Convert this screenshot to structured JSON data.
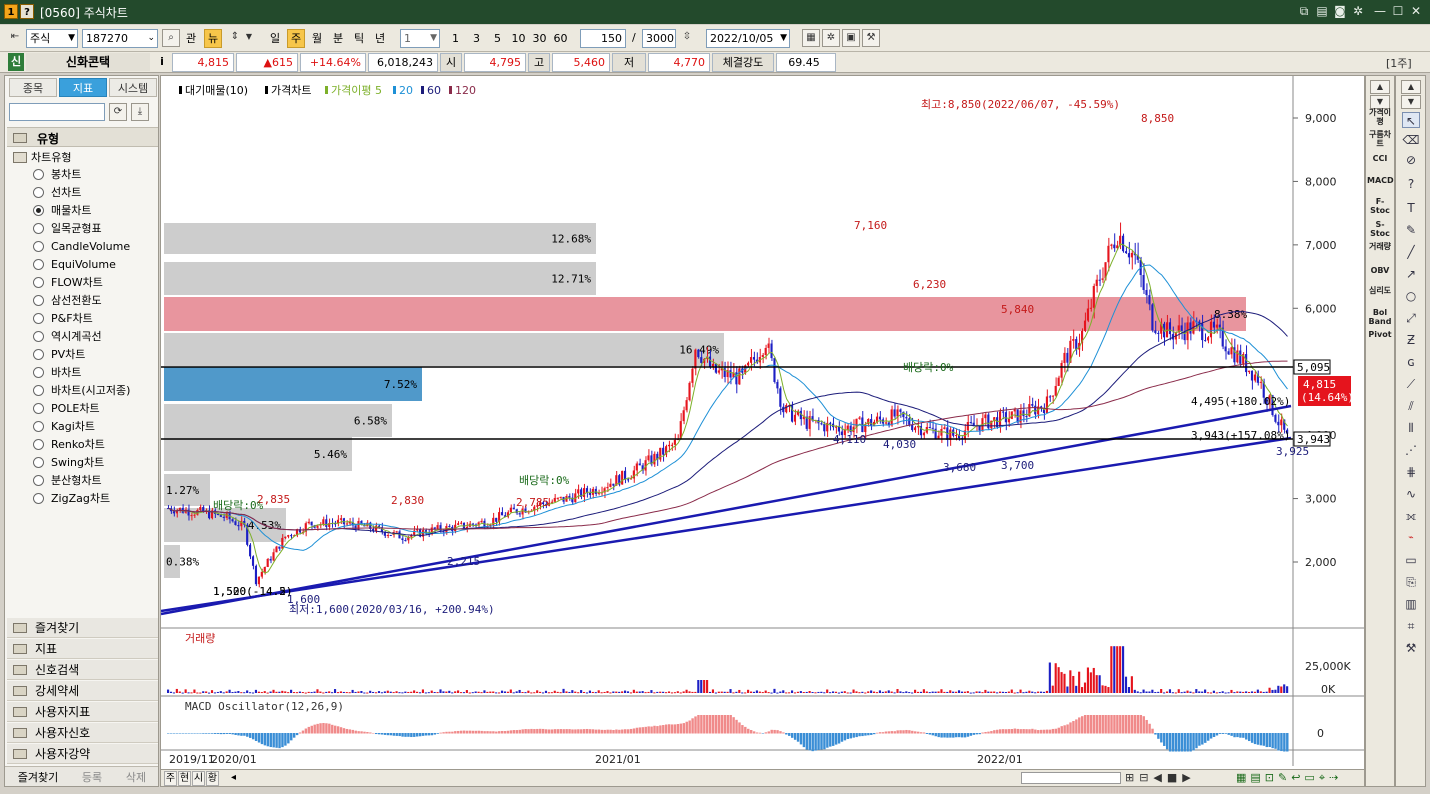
{
  "window": {
    "title": "[0560] 주식차트",
    "icon1": "1",
    "icon2": "?"
  },
  "toolbar": {
    "market": "주식",
    "code": "187270",
    "btn_gwan": "관",
    "btn_news": "뉴",
    "periods": [
      "일",
      "주",
      "월",
      "분",
      "틱",
      "년"
    ],
    "active_period": "주",
    "interval": "1",
    "intervals": [
      "1",
      "3",
      "5",
      "10",
      "30",
      "60"
    ],
    "count": "150",
    "total": "3000",
    "slash": "/",
    "date": "2022/10/05"
  },
  "quote": {
    "badge": "신",
    "name": "신화콘택",
    "info": "i",
    "price": "4,815",
    "change": "▲615",
    "pct": "+14.64%",
    "volume": "6,018,243",
    "open_label": "시",
    "open": "4,795",
    "high_label": "고",
    "high": "5,460",
    "low_label": "저",
    "low": "4,770",
    "strength_label": "체결강도",
    "strength": "69.45",
    "unit": "[1주]"
  },
  "left": {
    "tabs": [
      "종목",
      "지표",
      "시스템"
    ],
    "active_tab": "지표",
    "section": "유형",
    "group": "차트유형",
    "types": [
      "봉차트",
      "선차트",
      "매물차트",
      "일목균형표",
      "CandleVolume",
      "EquiVolume",
      "FLOW차트",
      "삼선전환도",
      "P&F차트",
      "역시계곡선",
      "PV차트",
      "바차트",
      "바차트(시고저종)",
      "POLE차트",
      "Kagi차트",
      "Renko차트",
      "Swing차트",
      "분산형차트",
      "ZigZag차트"
    ],
    "selected": "매물차트",
    "folders": [
      "즐겨찾기",
      "지표",
      "신호검색",
      "강세약세",
      "사용자지표",
      "사용자신호",
      "사용자강약"
    ],
    "bottom_tabs": [
      "즐겨찾기",
      "등록",
      "삭제"
    ]
  },
  "chart": {
    "legend": {
      "item1": "대기매물(10)",
      "item2": "가격차트",
      "item3": "가격이평 5",
      "ma20": "20",
      "ma60": "60",
      "ma120": "120"
    },
    "volume_title": "거래량",
    "macd_title": "MACD Oscillator(12,26,9)",
    "price_ticks": [
      "9,000",
      "8,000",
      "7,000",
      "6,000",
      "4,000",
      "3,000",
      "2,000"
    ],
    "price_tick_values": [
      9000,
      8000,
      7000,
      6000,
      4000,
      3000,
      2000
    ],
    "volume_ticks": [
      "25,000K",
      "0K"
    ],
    "macd_ticks": [
      "0"
    ],
    "time_labels": [
      "2019/11",
      "2020/01",
      "2021/01",
      "2022/01"
    ],
    "profile_labels": [
      "12.68%",
      "12.71%",
      "8.38%",
      "16.49%",
      "7.52%",
      "6.58%",
      "5.46%",
      "1.27%",
      "4.53%",
      "0.38%"
    ],
    "annotations": {
      "high": "최고:8,850(2022/06/07, -45.59%)",
      "low": "최저:1,600(2020/03/16, +200.94%)",
      "p8850": "8,850",
      "p7160": "7,160",
      "p6230": "6,230",
      "p5840": "5,840",
      "p4110": "4,110",
      "p4030": "4,030",
      "p3680": "3,680",
      "p3700": "3,700",
      "p3925": "3,925",
      "p2835": "2,835",
      "p2830": "2,830",
      "p2785": "2,785",
      "p2215": "2,215",
      "p1600": "1,600",
      "div1": "배당락:0%",
      "div2": "배당락:0%",
      "div3": "배당락:0%",
      "trend1": "4,495(+180.02%)",
      "trend2": "3,943(+157.08%)",
      "left1": "1,500(-14.5)",
      "left2": "1,520(-14.2)"
    },
    "price_box": {
      "current": "4,815",
      "current_pct": "(14.64%)",
      "line1": "5,095",
      "line2": "3,943"
    }
  },
  "right_indicators": [
    "가격이평",
    "구름차트",
    "CCI",
    "MACD",
    "F-Stoc",
    "S-Stoc",
    "거래량",
    "OBV",
    "심리도",
    "Bol Band",
    "Pivot"
  ],
  "bottom_tabs": [
    "주",
    "현",
    "시",
    "황"
  ]
}
